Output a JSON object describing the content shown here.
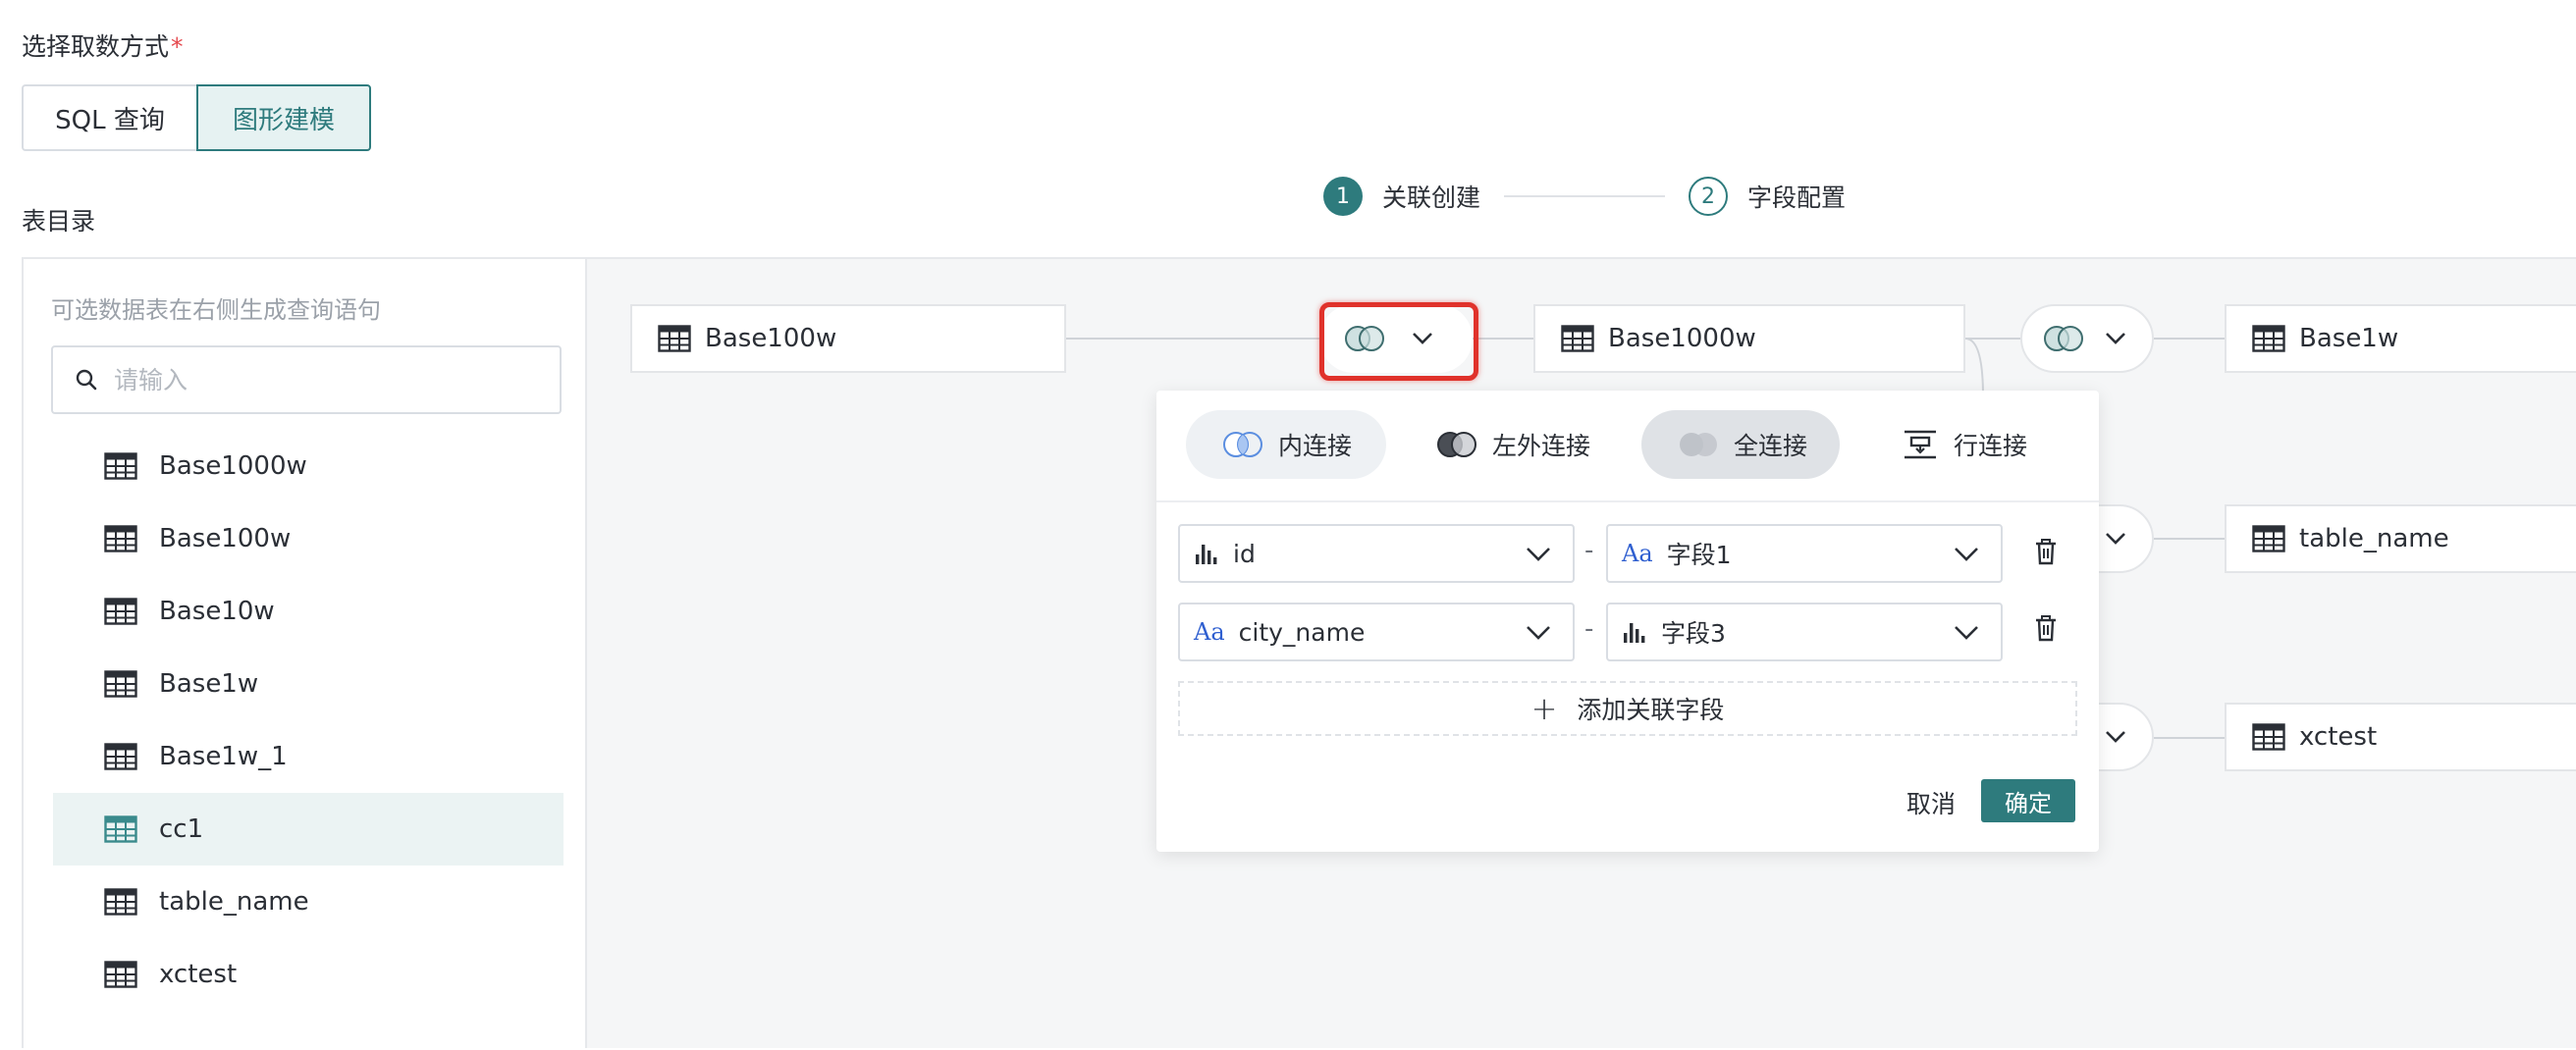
{
  "header": {
    "mode_label": "选择取数方式",
    "required_mark": "*",
    "mode_options": [
      "SQL 查询",
      "图形建模"
    ],
    "catalog_label": "表目录"
  },
  "steps": [
    {
      "num": "1",
      "label": "关联创建"
    },
    {
      "num": "2",
      "label": "字段配置"
    }
  ],
  "sidebar": {
    "tip": "可选数据表在右侧生成查询语句",
    "search_placeholder": "请输入",
    "tables": [
      {
        "name": "Base1000w"
      },
      {
        "name": "Base100w"
      },
      {
        "name": "Base10w"
      },
      {
        "name": "Base1w"
      },
      {
        "name": "Base1w_1"
      },
      {
        "name": "cc1",
        "selected": true
      },
      {
        "name": "table_name"
      },
      {
        "name": "xctest"
      }
    ]
  },
  "canvas": {
    "nodes": [
      "Base100w",
      "Base1000w",
      "Base1w",
      "table_name",
      "xctest"
    ]
  },
  "join_popup": {
    "join_types": [
      "内连接",
      "左外连接",
      "全连接",
      "行连接"
    ],
    "selected_join": "全连接",
    "rows": [
      {
        "left": "id",
        "left_type": "number",
        "right": "字段1",
        "right_type": "text"
      },
      {
        "left": "city_name",
        "left_type": "text",
        "right": "字段3",
        "right_type": "number"
      }
    ],
    "separator": "-",
    "add_field": "添加关联字段",
    "cancel": "取消",
    "confirm": "确定"
  },
  "colors": {
    "accent": "#2e7b7d",
    "highlight": "#e0322b",
    "canvas_bg": "#f5f6f7"
  }
}
